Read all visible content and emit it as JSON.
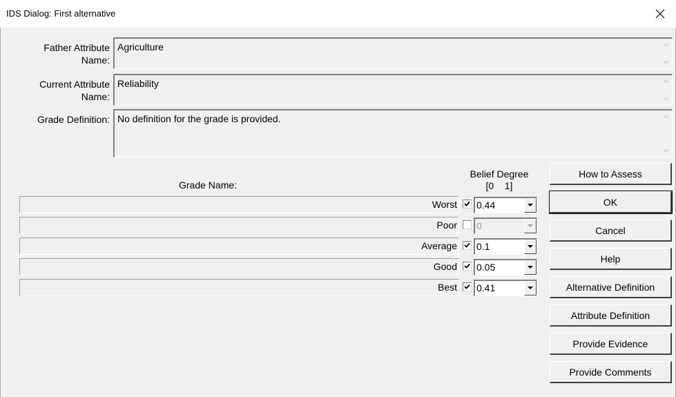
{
  "window": {
    "title": "IDS Dialog: First alternative"
  },
  "fields": {
    "father_label_1": "Father Attribute",
    "father_label_2": "Name:",
    "father_value": "Agriculture",
    "current_label_1": "Current Attribute",
    "current_label_2": "Name:",
    "current_value": "Reliability",
    "grade_def_label": "Grade Definition:",
    "grade_def_value": "No definition for the grade is provided."
  },
  "table": {
    "grade_name_header": "Grade Name:",
    "belief_header_1": "Belief Degree",
    "belief_header_2": "[0    1]",
    "rows": [
      {
        "name": "Worst",
        "checked": true,
        "value": "0.44",
        "enabled": true
      },
      {
        "name": "Poor",
        "checked": false,
        "value": "0",
        "enabled": false
      },
      {
        "name": "Average",
        "checked": true,
        "value": "0.1",
        "enabled": true
      },
      {
        "name": "Good",
        "checked": true,
        "value": "0.05",
        "enabled": true
      },
      {
        "name": "Best",
        "checked": true,
        "value": "0.41",
        "enabled": true
      }
    ]
  },
  "buttons": {
    "how_to_assess": "How to Assess",
    "ok": "OK",
    "cancel": "Cancel",
    "help": "Help",
    "alternative_definition": "Alternative Definition",
    "attribute_definition": "Attribute Definition",
    "provide_evidence": "Provide Evidence",
    "provide_comments": "Provide Comments"
  }
}
